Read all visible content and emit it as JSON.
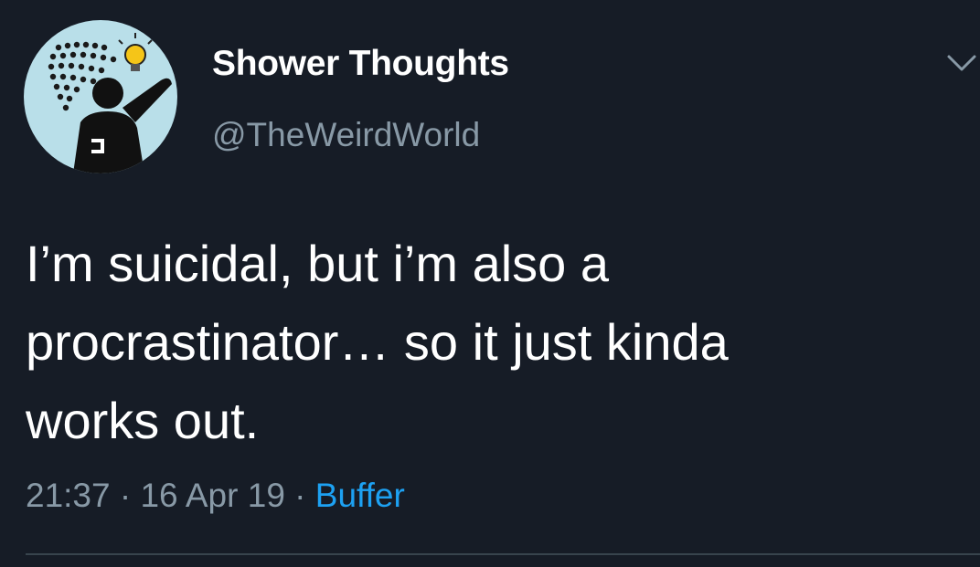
{
  "author": {
    "display_name": "Shower Thoughts",
    "handle": "@TheWeirdWorld",
    "avatar_icon": "shower-lightbulb-icon"
  },
  "tweet": {
    "text": "I’m suicidal, but i’m also a\nprocrastinator… so it just kinda\nworks out.",
    "time": "21:37",
    "date": "16 Apr 19",
    "separator": " · ",
    "source": "Buffer"
  },
  "menu": {
    "icon": "chevron-down-icon"
  },
  "colors": {
    "background": "#161c26",
    "text": "#ffffff",
    "muted": "#8899a6",
    "link": "#1da1f2"
  }
}
